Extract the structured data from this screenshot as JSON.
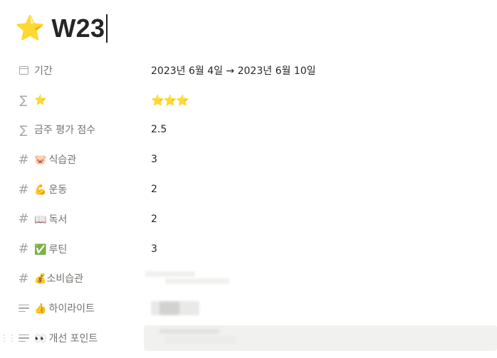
{
  "page": {
    "emoji": "⭐",
    "title": "W23"
  },
  "properties": [
    {
      "icon": "calendar-icon",
      "label": "기간",
      "value": "2023년 6월 4일 → 2023년 6월 10일"
    },
    {
      "icon": "sigma-icon",
      "label": "⭐",
      "value": "⭐⭐⭐"
    },
    {
      "icon": "sigma-icon",
      "label": "금주 평가 점수",
      "value": "2.5"
    },
    {
      "icon": "hash-icon",
      "label_emoji": "🐷",
      "label": "식습관",
      "value": "3"
    },
    {
      "icon": "hash-icon",
      "label_emoji": "💪",
      "label": "운동",
      "value": "2"
    },
    {
      "icon": "hash-icon",
      "label_emoji": "📖",
      "label": "독서",
      "value": "2"
    },
    {
      "icon": "hash-icon",
      "label_emoji": "✅",
      "label": "루틴",
      "value": "3"
    },
    {
      "icon": "hash-icon",
      "label_emoji": "💰",
      "label": "소비습관",
      "value": ""
    },
    {
      "icon": "text-lines-icon",
      "label_emoji": "👍",
      "label": "하이라이트",
      "value": ""
    },
    {
      "icon": "text-lines-icon",
      "label_emoji": "👀",
      "label": "개선 포인트",
      "value": ""
    }
  ],
  "colors": {
    "label": "#73726d",
    "value": "#262626",
    "icon": "#a6a5a2",
    "focus_bg": "#f1f1ef"
  }
}
